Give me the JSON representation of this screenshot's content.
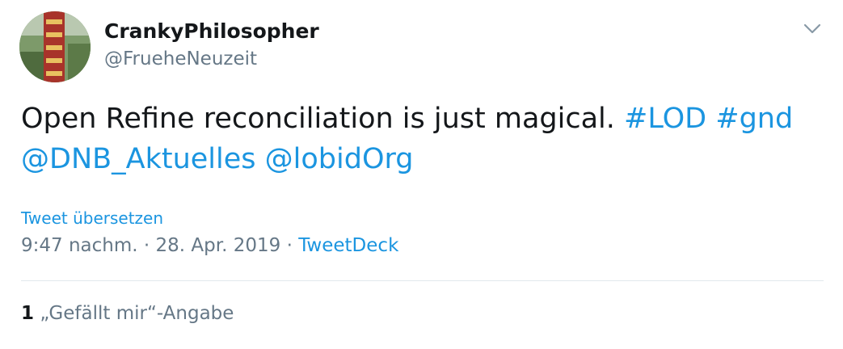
{
  "author": {
    "display_name": "CrankyPhilosopher",
    "handle": "@FrueheNeuzeit"
  },
  "tweet": {
    "text": "Open Refine reconciliation is just magical.",
    "links": [
      "#LOD",
      "#gnd",
      "@DNB_Aktuelles",
      "@lobidOrg"
    ]
  },
  "translate_label": "Tweet übersetzen",
  "meta": {
    "time": "9:47 nachm.",
    "separator": "·",
    "date": "28. Apr. 2019",
    "source": "TweetDeck"
  },
  "likes": {
    "count": "1",
    "label": "„Gefällt mir“-Angabe"
  },
  "icons": {
    "menu": "chevron-down-icon"
  },
  "colors": {
    "link": "#1b95e0",
    "secondary_text": "#657786",
    "primary_text": "#14171a",
    "divider": "#e1e8ed"
  }
}
